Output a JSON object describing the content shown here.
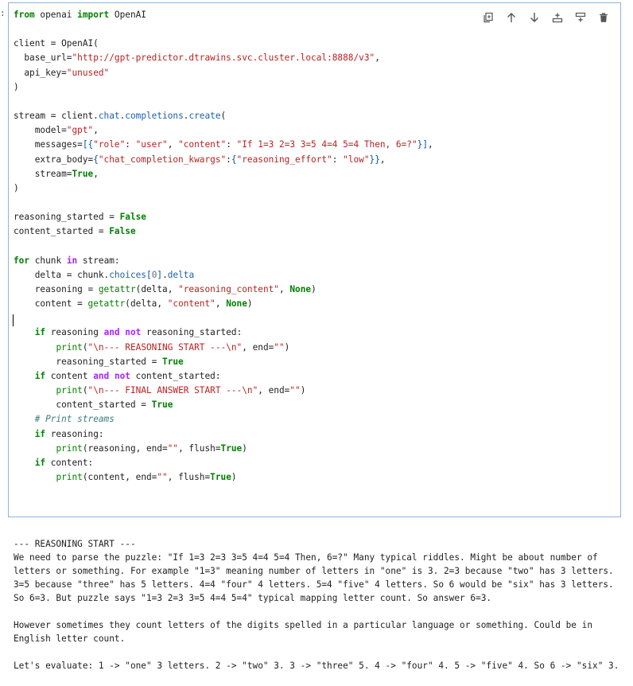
{
  "cell": {
    "marker": ":",
    "toolbar": [
      {
        "name": "duplicate-cell-icon",
        "title": "Duplicate cell"
      },
      {
        "name": "move-up-icon",
        "title": "Move cell up"
      },
      {
        "name": "move-down-icon",
        "title": "Move cell down"
      },
      {
        "name": "insert-above-icon",
        "title": "Insert cell above"
      },
      {
        "name": "insert-below-icon",
        "title": "Insert cell below"
      },
      {
        "name": "delete-icon",
        "title": "Delete cell"
      }
    ],
    "code_lines": [
      [
        [
          "kw",
          "from"
        ],
        [
          "p",
          " openai "
        ],
        [
          "kw",
          "import"
        ],
        [
          "p",
          " OpenAI"
        ]
      ],
      [],
      [
        [
          "p",
          "client = OpenAI("
        ]
      ],
      [
        [
          "p",
          "  base_url="
        ],
        [
          "str",
          "\"http://gpt-predictor.dtrawins.svc.cluster.local:8888/v3\""
        ],
        [
          "p",
          ","
        ]
      ],
      [
        [
          "p",
          "  api_key="
        ],
        [
          "str",
          "\"unused\""
        ]
      ],
      [
        [
          "p",
          ")"
        ]
      ],
      [],
      [
        [
          "p",
          "stream = client."
        ],
        [
          "attr",
          "chat"
        ],
        [
          "p",
          "."
        ],
        [
          "attr",
          "completions"
        ],
        [
          "p",
          "."
        ],
        [
          "attr",
          "create"
        ],
        [
          "p",
          "("
        ]
      ],
      [
        [
          "p",
          "    model="
        ],
        [
          "str",
          "\"gpt\""
        ],
        [
          "p",
          ","
        ]
      ],
      [
        [
          "p",
          "    messages="
        ],
        [
          "brk",
          "[{"
        ],
        [
          "str",
          "\"role\""
        ],
        [
          "p",
          ": "
        ],
        [
          "str",
          "\"user\""
        ],
        [
          "p",
          ", "
        ],
        [
          "str",
          "\"content\""
        ],
        [
          "p",
          ": "
        ],
        [
          "str",
          "\"If 1=3 2=3 3=5 4=4 5=4 Then, 6=?\""
        ],
        [
          "brk",
          "}]"
        ],
        [
          "p",
          ","
        ]
      ],
      [
        [
          "p",
          "    extra_body="
        ],
        [
          "brk",
          "{"
        ],
        [
          "str",
          "\"chat_completion_kwargs\""
        ],
        [
          "p",
          ":"
        ],
        [
          "brk",
          "{"
        ],
        [
          "str",
          "\"reasoning_effort\""
        ],
        [
          "p",
          ": "
        ],
        [
          "str",
          "\"low\""
        ],
        [
          "brk",
          "}}"
        ],
        [
          "p",
          ","
        ]
      ],
      [
        [
          "p",
          "    stream="
        ],
        [
          "kw",
          "True"
        ],
        [
          "p",
          ","
        ]
      ],
      [
        [
          "p",
          ")"
        ]
      ],
      [],
      [
        [
          "p",
          "reasoning_started = "
        ],
        [
          "kw",
          "False"
        ]
      ],
      [
        [
          "p",
          "content_started = "
        ],
        [
          "kw",
          "False"
        ]
      ],
      [],
      [
        [
          "kw",
          "for"
        ],
        [
          "p",
          " chunk "
        ],
        [
          "op",
          "in"
        ],
        [
          "p",
          " stream:"
        ]
      ],
      [
        [
          "p",
          "    delta = chunk."
        ],
        [
          "attr",
          "choices"
        ],
        [
          "brk",
          "["
        ],
        [
          "num",
          "0"
        ],
        [
          "brk",
          "]"
        ],
        [
          "p",
          "."
        ],
        [
          "attr",
          "delta"
        ]
      ],
      [
        [
          "p",
          "    reasoning = "
        ],
        [
          "bi",
          "getattr"
        ],
        [
          "p",
          "(delta, "
        ],
        [
          "str",
          "\"reasoning_content\""
        ],
        [
          "p",
          ", "
        ],
        [
          "kw",
          "None"
        ],
        [
          "p",
          ")"
        ]
      ],
      [
        [
          "p",
          "    content = "
        ],
        [
          "bi",
          "getattr"
        ],
        [
          "p",
          "(delta, "
        ],
        [
          "str",
          "\"content\""
        ],
        [
          "p",
          ", "
        ],
        [
          "kw",
          "None"
        ],
        [
          "p",
          ")"
        ]
      ],
      [],
      [
        [
          "p",
          "    "
        ],
        [
          "kw",
          "if"
        ],
        [
          "p",
          " reasoning "
        ],
        [
          "op",
          "and"
        ],
        [
          "p",
          " "
        ],
        [
          "op",
          "not"
        ],
        [
          "p",
          " reasoning_started:"
        ]
      ],
      [
        [
          "p",
          "        "
        ],
        [
          "bi",
          "print"
        ],
        [
          "p",
          "("
        ],
        [
          "str",
          "\"\\n--- REASONING START ---\\n\""
        ],
        [
          "p",
          ", end="
        ],
        [
          "str",
          "\"\""
        ],
        [
          "p",
          ")"
        ]
      ],
      [
        [
          "p",
          "        reasoning_started = "
        ],
        [
          "kw",
          "True"
        ]
      ],
      [
        [
          "p",
          "    "
        ],
        [
          "kw",
          "if"
        ],
        [
          "p",
          " content "
        ],
        [
          "op",
          "and"
        ],
        [
          "p",
          " "
        ],
        [
          "op",
          "not"
        ],
        [
          "p",
          " content_started:"
        ]
      ],
      [
        [
          "p",
          "        "
        ],
        [
          "bi",
          "print"
        ],
        [
          "p",
          "("
        ],
        [
          "str",
          "\"\\n--- FINAL ANSWER START ---\\n\""
        ],
        [
          "p",
          ", end="
        ],
        [
          "str",
          "\"\""
        ],
        [
          "p",
          ")"
        ]
      ],
      [
        [
          "p",
          "        content_started = "
        ],
        [
          "kw",
          "True"
        ]
      ],
      [
        [
          "p",
          "    "
        ],
        [
          "cm",
          "# Print streams"
        ]
      ],
      [
        [
          "p",
          "    "
        ],
        [
          "kw",
          "if"
        ],
        [
          "p",
          " reasoning:"
        ]
      ],
      [
        [
          "p",
          "        "
        ],
        [
          "bi",
          "print"
        ],
        [
          "p",
          "(reasoning, end="
        ],
        [
          "str",
          "\"\""
        ],
        [
          "p",
          ", flush="
        ],
        [
          "kw",
          "True"
        ],
        [
          "p",
          ")"
        ]
      ],
      [
        [
          "p",
          "    "
        ],
        [
          "kw",
          "if"
        ],
        [
          "p",
          " content:"
        ]
      ],
      [
        [
          "p",
          "        "
        ],
        [
          "bi",
          "print"
        ],
        [
          "p",
          "(content, end="
        ],
        [
          "str",
          "\"\""
        ],
        [
          "p",
          ", flush="
        ],
        [
          "kw",
          "True"
        ],
        [
          "p",
          ")"
        ]
      ]
    ]
  },
  "output": {
    "paragraphs": [
      "--- REASONING START ---\nWe need to parse the puzzle: \"If 1=3 2=3 3=5 4=4 5=4 Then, 6=?\" Many typical riddles. Might be about number of letters or something. For example \"1=3\" meaning number of letters in \"one\" is 3. 2=3 because \"two\" has 3 letters. 3=5 because \"three\" has 5 letters. 4=4 \"four\" 4 letters. 5=4 \"five\" 4 letters. So 6 would be \"six\" has 3 letters. So 6=3. But puzzle says \"1=3 2=3 3=5 4=4 5=4\" typical mapping letter count. So answer 6=3.",
      "However sometimes they count letters of the digits spelled in a particular language or something. Could be in English letter count.",
      "Let's evaluate: 1 -> \"one\" 3 letters. 2 -> \"two\" 3. 3 -> \"three\" 5. 4 -> \"four\" 4. 5 -> \"five\" 4. So 6 -> \"six\" 3."
    ]
  }
}
